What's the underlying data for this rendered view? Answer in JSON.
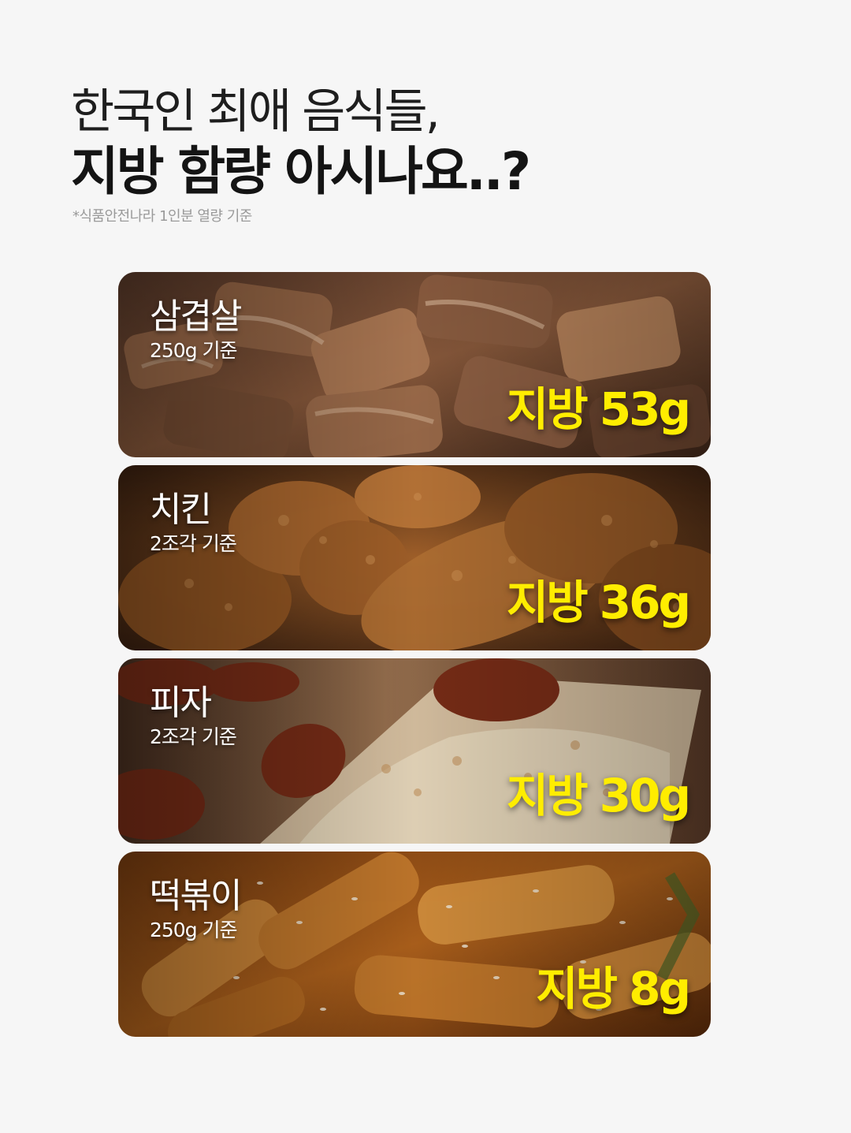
{
  "header": {
    "title_line1": "한국인 최애 음식들,",
    "title_line2": "지방 함량 아시나요..?",
    "source_note": "*식품안전나라 1인분 열량 기준"
  },
  "foods": [
    {
      "name": "삼겹살",
      "portion": "250g 기준",
      "fat": "지방 53g"
    },
    {
      "name": "치킨",
      "portion": "2조각 기준",
      "fat": "지방 36g"
    },
    {
      "name": "피자",
      "portion": "2조각 기준",
      "fat": "지방 30g"
    },
    {
      "name": "떡볶이",
      "portion": "250g 기준",
      "fat": "지방 8g"
    }
  ],
  "colors": {
    "background": "#f6f6f6",
    "fat_highlight": "#ffed00"
  }
}
